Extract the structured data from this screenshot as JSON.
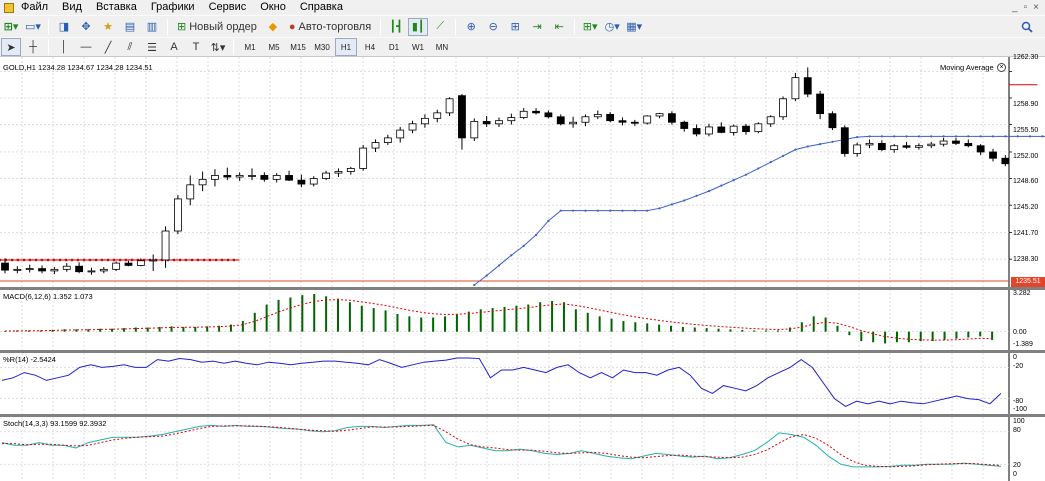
{
  "menu": {
    "items": [
      "Файл",
      "Вид",
      "Вставка",
      "Графики",
      "Сервис",
      "Окно",
      "Справка"
    ],
    "window_controls": [
      "_",
      "▫",
      "×"
    ]
  },
  "toolbar": {
    "new_order_label": "Новый ордер",
    "autotrading_label": "Авто-торговля",
    "search_icon": "search-icon"
  },
  "timeframes": {
    "items": [
      "M1",
      "M5",
      "M15",
      "M30",
      "H1",
      "H4",
      "D1",
      "W1",
      "MN"
    ],
    "active": "H1"
  },
  "main_chart": {
    "header": "GOLD,H1  1234.28 1234.67 1234.28 1234.51",
    "indicator_label": "Moving Average",
    "current_price": "1235.51",
    "price_ticks": [
      "1262.30",
      "1258.90",
      "1255.50",
      "1252.00",
      "1248.60",
      "1245.20",
      "1241.70",
      "1238.30"
    ],
    "colors": {
      "bull": "#ffffff",
      "bear": "#000000",
      "ma": "#3a5fcd",
      "stop_line": "#e00000",
      "price_line": "#e2462a"
    }
  },
  "macd": {
    "header": "MACD(6,12,6) 1.352 1.073",
    "ticks": [
      "3.282",
      "0.00",
      "-1.389"
    ],
    "colors": {
      "hist": "#006400",
      "signal": "#e00000"
    }
  },
  "wpr": {
    "header": "%R(14) -2.5424",
    "ticks": [
      "0",
      "-20",
      "-80",
      "-100"
    ],
    "color": "#1f1fcf"
  },
  "stoch": {
    "header": "Stoch(14,3,3) 93.1599 92.3932",
    "ticks": [
      "100",
      "80",
      "20",
      "0"
    ],
    "colors": {
      "main": "#20b2aa",
      "signal": "#e00000"
    }
  },
  "chart_data": {
    "type": "candlestick",
    "symbol": "GOLD",
    "timeframe": "H1",
    "ylim": [
      1235.0,
      1263.5
    ],
    "candles": [
      [
        1237.8,
        1238.4,
        1236.5,
        1236.9
      ],
      [
        1236.9,
        1237.4,
        1236.5,
        1237.0
      ],
      [
        1237.0,
        1237.6,
        1236.6,
        1237.1
      ],
      [
        1237.1,
        1237.5,
        1236.5,
        1236.8
      ],
      [
        1236.8,
        1237.3,
        1236.4,
        1237.0
      ],
      [
        1237.0,
        1237.8,
        1236.7,
        1237.4
      ],
      [
        1237.4,
        1237.9,
        1236.5,
        1236.7
      ],
      [
        1236.7,
        1237.2,
        1236.3,
        1236.8
      ],
      [
        1236.8,
        1237.3,
        1236.5,
        1237.0
      ],
      [
        1237.0,
        1238.0,
        1236.8,
        1237.8
      ],
      [
        1237.8,
        1238.1,
        1237.4,
        1237.5
      ],
      [
        1237.5,
        1238.4,
        1237.4,
        1238.1
      ],
      [
        1238.1,
        1238.9,
        1236.8,
        1238.2
      ],
      [
        1238.2,
        1242.5,
        1237.2,
        1241.9
      ],
      [
        1241.9,
        1246.5,
        1241.5,
        1246.0
      ],
      [
        1246.0,
        1249.0,
        1245.2,
        1247.8
      ],
      [
        1247.8,
        1249.5,
        1247.0,
        1248.5
      ],
      [
        1248.5,
        1249.8,
        1247.6,
        1249.0
      ],
      [
        1249.0,
        1250.0,
        1248.4,
        1248.8
      ],
      [
        1248.8,
        1249.4,
        1248.3,
        1249.0
      ],
      [
        1249.0,
        1249.9,
        1248.4,
        1249.0
      ],
      [
        1249.0,
        1249.4,
        1248.2,
        1248.5
      ],
      [
        1248.5,
        1249.3,
        1248.1,
        1249.0
      ],
      [
        1249.0,
        1249.6,
        1248.3,
        1248.4
      ],
      [
        1248.4,
        1249.1,
        1247.5,
        1247.9
      ],
      [
        1247.9,
        1248.9,
        1247.6,
        1248.6
      ],
      [
        1248.6,
        1249.6,
        1248.4,
        1249.3
      ],
      [
        1249.3,
        1249.9,
        1248.8,
        1249.5
      ],
      [
        1249.5,
        1250.1,
        1249.1,
        1249.9
      ],
      [
        1249.9,
        1252.9,
        1249.6,
        1252.5
      ],
      [
        1252.5,
        1253.6,
        1252.0,
        1253.2
      ],
      [
        1253.2,
        1254.2,
        1252.9,
        1253.8
      ],
      [
        1253.8,
        1255.2,
        1253.2,
        1254.8
      ],
      [
        1254.8,
        1256.0,
        1254.4,
        1255.6
      ],
      [
        1255.6,
        1256.8,
        1255.1,
        1256.3
      ],
      [
        1256.3,
        1257.4,
        1255.8,
        1257.0
      ],
      [
        1257.0,
        1259.0,
        1256.6,
        1258.8
      ],
      [
        1259.2,
        1259.4,
        1252.3,
        1253.8
      ],
      [
        1253.8,
        1256.3,
        1253.4,
        1255.9
      ],
      [
        1255.9,
        1256.6,
        1255.2,
        1255.6
      ],
      [
        1255.6,
        1256.4,
        1255.2,
        1256.0
      ],
      [
        1256.0,
        1256.9,
        1255.5,
        1256.4
      ],
      [
        1256.4,
        1257.6,
        1256.2,
        1257.2
      ],
      [
        1257.2,
        1257.6,
        1256.8,
        1257.0
      ],
      [
        1257.0,
        1257.3,
        1256.3,
        1256.5
      ],
      [
        1256.5,
        1256.8,
        1255.4,
        1255.6
      ],
      [
        1255.6,
        1256.5,
        1255.1,
        1255.8
      ],
      [
        1255.8,
        1256.8,
        1255.3,
        1256.5
      ],
      [
        1256.5,
        1257.3,
        1256.2,
        1256.8
      ],
      [
        1256.8,
        1257.1,
        1255.8,
        1256.0
      ],
      [
        1256.0,
        1256.4,
        1255.4,
        1255.8
      ],
      [
        1255.8,
        1256.1,
        1255.3,
        1255.7
      ],
      [
        1255.7,
        1256.7,
        1255.5,
        1256.6
      ],
      [
        1256.6,
        1257.0,
        1256.3,
        1256.9
      ],
      [
        1256.9,
        1257.2,
        1255.5,
        1255.8
      ],
      [
        1255.8,
        1256.0,
        1254.6,
        1255.0
      ],
      [
        1255.0,
        1255.5,
        1254.0,
        1254.3
      ],
      [
        1254.3,
        1255.6,
        1254.0,
        1255.2
      ],
      [
        1255.2,
        1255.8,
        1254.4,
        1254.5
      ],
      [
        1254.5,
        1255.5,
        1254.1,
        1255.3
      ],
      [
        1255.3,
        1255.6,
        1254.2,
        1254.6
      ],
      [
        1254.6,
        1255.8,
        1254.4,
        1255.6
      ],
      [
        1255.6,
        1256.7,
        1255.2,
        1256.5
      ],
      [
        1256.5,
        1259.1,
        1256.1,
        1258.8
      ],
      [
        1258.8,
        1262.1,
        1258.5,
        1261.5
      ],
      [
        1261.5,
        1262.8,
        1259.0,
        1259.4
      ],
      [
        1259.4,
        1259.8,
        1256.2,
        1256.9
      ],
      [
        1256.9,
        1257.2,
        1254.8,
        1255.1
      ],
      [
        1255.1,
        1255.4,
        1251.4,
        1251.8
      ],
      [
        1251.8,
        1253.2,
        1251.4,
        1252.9
      ],
      [
        1252.9,
        1253.6,
        1252.5,
        1253.1
      ],
      [
        1253.1,
        1253.5,
        1252.1,
        1252.3
      ],
      [
        1252.3,
        1253.0,
        1251.9,
        1252.8
      ],
      [
        1252.8,
        1253.3,
        1252.4,
        1252.6
      ],
      [
        1252.6,
        1253.1,
        1252.3,
        1252.8
      ],
      [
        1252.8,
        1253.3,
        1252.5,
        1253.0
      ],
      [
        1253.0,
        1253.8,
        1252.7,
        1253.4
      ],
      [
        1253.4,
        1253.8,
        1252.9,
        1253.1
      ],
      [
        1253.1,
        1253.6,
        1252.6,
        1252.8
      ],
      [
        1252.8,
        1253.0,
        1251.6,
        1252.0
      ],
      [
        1252.0,
        1252.4,
        1250.8,
        1251.2
      ],
      [
        1251.2,
        1251.6,
        1250.2,
        1250.5
      ]
    ],
    "moving_average": [
      [
        38,
        1235.0
      ],
      [
        39,
        1236.2
      ],
      [
        40,
        1237.5
      ],
      [
        41,
        1238.8
      ],
      [
        42,
        1240.0
      ],
      [
        43,
        1241.4
      ],
      [
        44,
        1243.2
      ],
      [
        45,
        1244.5
      ],
      [
        46,
        1244.5
      ],
      [
        47,
        1244.5
      ],
      [
        48,
        1244.5
      ],
      [
        49,
        1244.5
      ],
      [
        50,
        1244.5
      ],
      [
        51,
        1244.5
      ],
      [
        52,
        1244.5
      ],
      [
        53,
        1244.8
      ],
      [
        54,
        1245.3
      ],
      [
        55,
        1245.8
      ],
      [
        56,
        1246.4
      ],
      [
        57,
        1247.0
      ],
      [
        58,
        1247.7
      ],
      [
        59,
        1248.4
      ],
      [
        60,
        1249.1
      ],
      [
        61,
        1249.9
      ],
      [
        62,
        1250.7
      ],
      [
        63,
        1251.5
      ],
      [
        64,
        1252.3
      ],
      [
        65,
        1252.7
      ],
      [
        66,
        1253.0
      ],
      [
        67,
        1253.3
      ],
      [
        68,
        1253.6
      ],
      [
        69,
        1253.9
      ],
      [
        70,
        1254.0
      ],
      [
        71,
        1254.0
      ],
      [
        72,
        1254.0
      ],
      [
        73,
        1254.0
      ],
      [
        74,
        1254.0
      ],
      [
        75,
        1254.0
      ],
      [
        76,
        1254.0
      ],
      [
        77,
        1254.0
      ],
      [
        78,
        1254.0
      ],
      [
        79,
        1254.0
      ],
      [
        80,
        1254.0
      ],
      [
        81,
        1254.0
      ],
      [
        82,
        1254.0
      ],
      [
        83,
        1254.0
      ],
      [
        84,
        1254.0
      ],
      [
        85,
        1254.0
      ],
      [
        86,
        1254.0
      ],
      [
        87,
        1254.0
      ],
      [
        88,
        1254.0
      ],
      [
        89,
        1254.0
      ],
      [
        90,
        1254.0
      ],
      [
        91,
        1254.0
      ],
      [
        92,
        1254.0
      ],
      [
        93,
        1254.0
      ],
      [
        94,
        1254.0
      ]
    ],
    "stop_levels": [
      {
        "from": 0,
        "to": 19,
        "price": 1238.2
      },
      {
        "from": 84,
        "to": 123,
        "price": 1260.6
      }
    ],
    "macd_hist": [
      0.05,
      0.1,
      0.1,
      0.1,
      0.15,
      0.2,
      0.2,
      0.2,
      0.25,
      0.25,
      0.3,
      0.35,
      0.35,
      0.4,
      0.45,
      0.4,
      0.4,
      0.45,
      0.5,
      0.6,
      0.9,
      1.6,
      2.3,
      2.7,
      2.9,
      3.1,
      3.2,
      3.0,
      2.8,
      2.5,
      2.2,
      2.0,
      1.8,
      1.5,
      1.3,
      1.2,
      1.2,
      1.3,
      1.5,
      1.7,
      1.9,
      2.0,
      2.1,
      2.2,
      2.3,
      2.5,
      2.6,
      2.5,
      1.9,
      1.6,
      1.3,
      1.1,
      0.9,
      0.8,
      0.7,
      0.6,
      0.5,
      0.4,
      0.35,
      0.3,
      0.25,
      0.2,
      0.15,
      0.1,
      0.1,
      0.1,
      0.35,
      0.8,
      1.3,
      1.2,
      0.5,
      -0.3,
      -0.8,
      -0.9,
      -1.0,
      -0.9,
      -0.9,
      -0.8,
      -0.8,
      -0.7,
      -0.6,
      -0.5,
      -0.4,
      -0.7
    ],
    "wpr": [
      -45,
      -40,
      -30,
      -35,
      -45,
      -40,
      -35,
      -20,
      -15,
      -20,
      -18,
      -15,
      -20,
      -20,
      -5,
      -8,
      -3,
      -5,
      -10,
      -8,
      -12,
      -8,
      -12,
      -15,
      -10,
      -12,
      -15,
      -12,
      -10,
      -8,
      -8,
      -10,
      -12,
      -15,
      -5,
      -12,
      -20,
      -15,
      -10,
      -8,
      -6,
      -2,
      -2,
      -3,
      -40,
      -25,
      -25,
      -20,
      -25,
      -30,
      -20,
      -15,
      -30,
      -40,
      -30,
      -40,
      -25,
      -30,
      -30,
      -35,
      -25,
      -20,
      -35,
      -60,
      -70,
      -55,
      -60,
      -65,
      -55,
      -40,
      -30,
      -20,
      -5,
      -20,
      -50,
      -80,
      -95,
      -85,
      -90,
      -85,
      -90,
      -85,
      -88,
      -90,
      -85,
      -80,
      -75,
      -80,
      -82,
      -90,
      -70
    ],
    "stoch_main": [
      60,
      55,
      55,
      60,
      55,
      55,
      50,
      60,
      65,
      70,
      70,
      70,
      72,
      75,
      80,
      85,
      90,
      92,
      90,
      92,
      90,
      90,
      88,
      86,
      85,
      82,
      80,
      82,
      88,
      90,
      90,
      88,
      90,
      92,
      92,
      93,
      60,
      52,
      55,
      50,
      45,
      45,
      48,
      45,
      40,
      38,
      40,
      45,
      40,
      35,
      32,
      30,
      35,
      40,
      38,
      35,
      33,
      35,
      30,
      32,
      38,
      45,
      60,
      78,
      75,
      70,
      55,
      35,
      20,
      15,
      15,
      15,
      16,
      18,
      18,
      20,
      20,
      20,
      22,
      20,
      18,
      16
    ],
    "stoch_signal": [
      58,
      58,
      56,
      57,
      57,
      55,
      54,
      55,
      60,
      65,
      68,
      70,
      71,
      72,
      76,
      81,
      86,
      90,
      91,
      91,
      91,
      90,
      89,
      87,
      85,
      83,
      82,
      81,
      83,
      86,
      89,
      89,
      89,
      90,
      91,
      92,
      80,
      66,
      56,
      52,
      50,
      47,
      46,
      46,
      44,
      41,
      40,
      41,
      42,
      40,
      36,
      33,
      32,
      34,
      36,
      37,
      35,
      34,
      33,
      32,
      33,
      38,
      46,
      59,
      71,
      75,
      68,
      55,
      38,
      25,
      18,
      16,
      15,
      16,
      17,
      19,
      20,
      21,
      21,
      21,
      19,
      18
    ]
  }
}
